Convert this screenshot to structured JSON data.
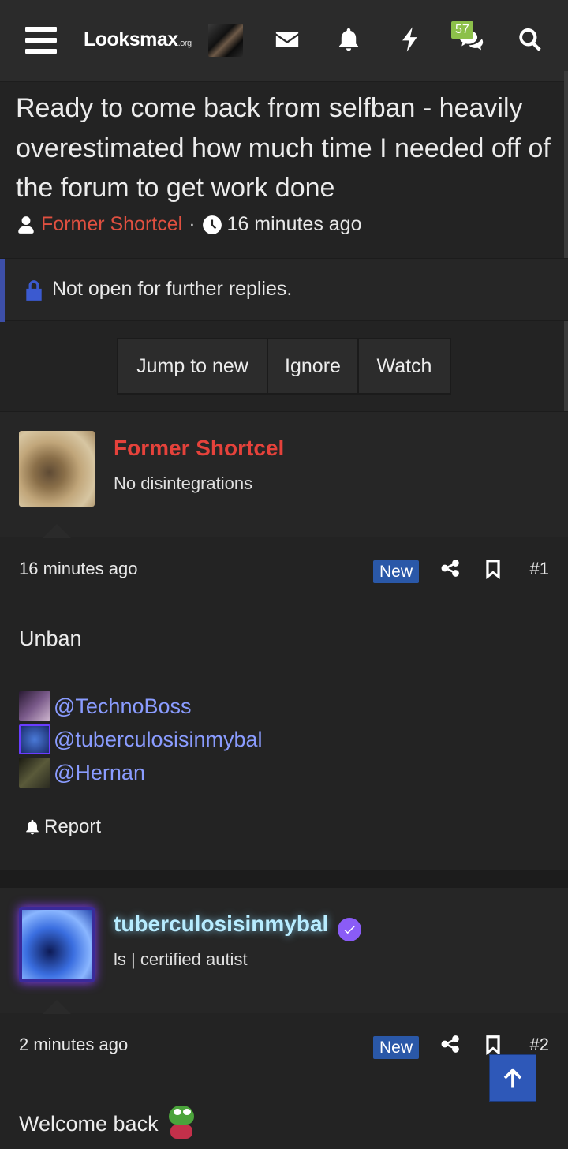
{
  "nav": {
    "logo_main": "Looksmax",
    "logo_suffix": ".org",
    "chat_badge": "57"
  },
  "thread": {
    "title": "Ready to come back from selfban - heavily overestimated how much time I needed off of the forum to get work done",
    "author": "Former Shortcel",
    "separator": "·",
    "time": "16 minutes ago",
    "locked_notice": "Not open for further replies."
  },
  "actions": {
    "jump": "Jump to new",
    "ignore": "Ignore",
    "watch": "Watch"
  },
  "posts": [
    {
      "username": "Former Shortcel",
      "user_title": "No disintegrations",
      "time": "16 minutes ago",
      "new_label": "New",
      "number": "#1",
      "message": "Unban",
      "mentions": [
        "@TechnoBoss",
        "@tuberculosisinmybal",
        "@Hernan"
      ],
      "report": "Report"
    },
    {
      "username": "tuberculosisinmybal",
      "user_title": "ls | certified autist",
      "time": "2 minutes ago",
      "new_label": "New",
      "number": "#2",
      "message": "Welcome back"
    }
  ],
  "colors": {
    "background": "#232323",
    "panel": "#262626",
    "author_red": "#e5423b",
    "new_badge": "#2a58a8",
    "mention": "#8a9cff",
    "badge_green": "#8cc04a",
    "verified_purple": "#8a5cf6"
  },
  "icons": [
    "menu-icon",
    "envelope-icon",
    "bell-icon",
    "bolt-icon",
    "chat-icon",
    "search-icon",
    "user-icon",
    "clock-icon",
    "lock-icon",
    "share-icon",
    "bookmark-icon",
    "bell-report-icon",
    "check-icon",
    "arrow-up-icon"
  ]
}
